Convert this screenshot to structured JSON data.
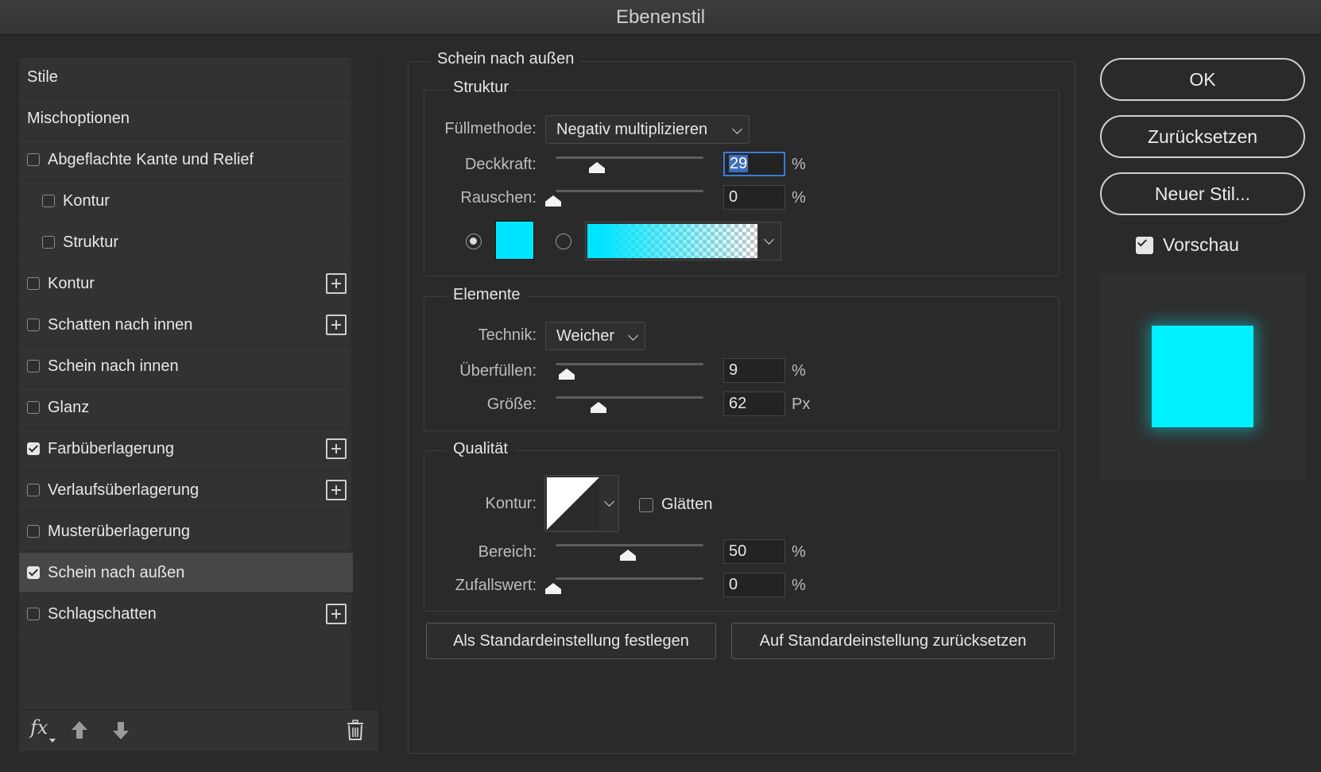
{
  "window": {
    "title": "Ebenenstil"
  },
  "styles_list": {
    "items": [
      {
        "label": "Stile",
        "checkbox": false,
        "checked": false,
        "plus": false,
        "indent": false,
        "selected": false
      },
      {
        "label": "Mischoptionen",
        "checkbox": false,
        "checked": false,
        "plus": false,
        "indent": false,
        "selected": false
      },
      {
        "label": "Abgeflachte Kante und Relief",
        "checkbox": true,
        "checked": false,
        "plus": false,
        "indent": false,
        "selected": false
      },
      {
        "label": "Kontur",
        "checkbox": true,
        "checked": false,
        "plus": false,
        "indent": true,
        "selected": false
      },
      {
        "label": "Struktur",
        "checkbox": true,
        "checked": false,
        "plus": false,
        "indent": true,
        "selected": false
      },
      {
        "label": "Kontur",
        "checkbox": true,
        "checked": false,
        "plus": true,
        "indent": false,
        "selected": false
      },
      {
        "label": "Schatten nach innen",
        "checkbox": true,
        "checked": false,
        "plus": true,
        "indent": false,
        "selected": false
      },
      {
        "label": "Schein nach innen",
        "checkbox": true,
        "checked": false,
        "plus": false,
        "indent": false,
        "selected": false
      },
      {
        "label": "Glanz",
        "checkbox": true,
        "checked": false,
        "plus": false,
        "indent": false,
        "selected": false
      },
      {
        "label": "Farbüberlagerung",
        "checkbox": true,
        "checked": true,
        "plus": true,
        "indent": false,
        "selected": false
      },
      {
        "label": "Verlaufsüberlagerung",
        "checkbox": true,
        "checked": false,
        "plus": true,
        "indent": false,
        "selected": false
      },
      {
        "label": "Musterüberlagerung",
        "checkbox": true,
        "checked": false,
        "plus": false,
        "indent": false,
        "selected": false
      },
      {
        "label": "Schein nach außen",
        "checkbox": true,
        "checked": true,
        "plus": false,
        "indent": false,
        "selected": true
      },
      {
        "label": "Schlagschatten",
        "checkbox": true,
        "checked": false,
        "plus": true,
        "indent": false,
        "selected": false
      }
    ],
    "footer": {
      "fx_label": "fx",
      "icons": [
        "fx-icon",
        "arrow-up-icon",
        "arrow-down-icon",
        "trash-icon"
      ]
    }
  },
  "panel": {
    "title": "Schein nach außen",
    "structure": {
      "legend": "Struktur",
      "blend_label": "Füllmethode:",
      "blend_value": "Negativ multiplizieren",
      "opacity_label": "Deckkraft:",
      "opacity_value": "29",
      "opacity_unit": "%",
      "noise_label": "Rauschen:",
      "noise_value": "0",
      "noise_unit": "%",
      "color_mode": "solid",
      "swatch_color": "#00e5ff"
    },
    "elements": {
      "legend": "Elemente",
      "technique_label": "Technik:",
      "technique_value": "Weicher",
      "spread_label": "Überfüllen:",
      "spread_value": "9",
      "spread_unit": "%",
      "size_label": "Größe:",
      "size_value": "62",
      "size_unit": "Px"
    },
    "quality": {
      "legend": "Qualität",
      "contour_label": "Kontur:",
      "antialias_label": "Glätten",
      "antialias_checked": false,
      "range_label": "Bereich:",
      "range_value": "50",
      "range_unit": "%",
      "jitter_label": "Zufallswert:",
      "jitter_value": "0",
      "jitter_unit": "%"
    },
    "buttons": {
      "set_default": "Als Standardeinstellung festlegen",
      "reset_default": "Auf Standardeinstellung zurücksetzen"
    }
  },
  "right": {
    "ok": "OK",
    "reset": "Zurücksetzen",
    "new_style": "Neuer Stil...",
    "preview_label": "Vorschau",
    "preview_checked": true,
    "preview_color": "#00f0ff"
  }
}
